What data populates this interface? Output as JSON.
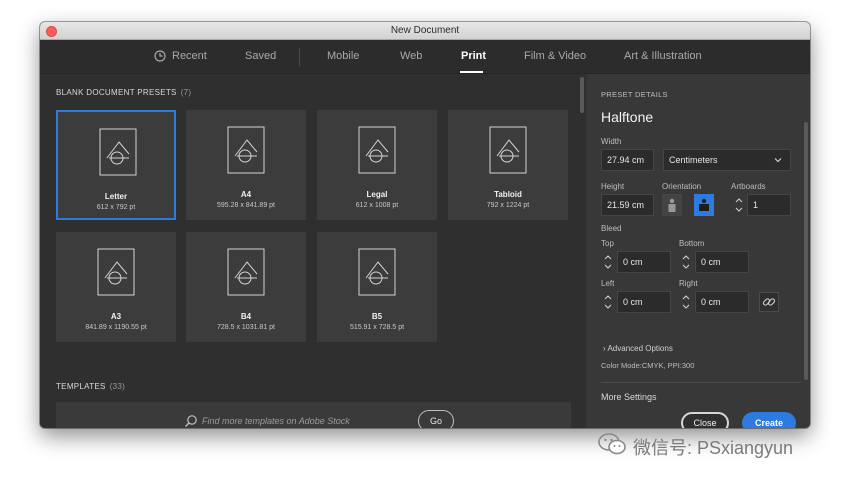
{
  "window": {
    "title": "New Document"
  },
  "tabs": [
    {
      "label": "Recent",
      "icon": "clock-icon",
      "active": false
    },
    {
      "label": "Saved",
      "active": false
    },
    {
      "label": "Mobile",
      "active": false
    },
    {
      "label": "Web",
      "active": false
    },
    {
      "label": "Print",
      "active": true
    },
    {
      "label": "Film & Video",
      "active": false
    },
    {
      "label": "Art & Illustration",
      "active": false
    }
  ],
  "presets_section": {
    "title": "BLANK DOCUMENT PRESETS",
    "count": "(7)"
  },
  "presets": [
    {
      "name": "Letter",
      "size": "612 x 792 pt",
      "selected": true
    },
    {
      "name": "A4",
      "size": "595.28 x 841.89 pt",
      "selected": false
    },
    {
      "name": "Legal",
      "size": "612 x 1008 pt",
      "selected": false
    },
    {
      "name": "Tabloid",
      "size": "792 x 1224 pt",
      "selected": false
    },
    {
      "name": "A3",
      "size": "841.89 x 1190.55 pt",
      "selected": false
    },
    {
      "name": "B4",
      "size": "728.5 x 1031.81 pt",
      "selected": false
    },
    {
      "name": "B5",
      "size": "515.91 x 728.5 pt",
      "selected": false
    }
  ],
  "templates_section": {
    "title": "TEMPLATES",
    "count": "(33)"
  },
  "search": {
    "placeholder": "Find more templates on Adobe Stock",
    "go_label": "Go"
  },
  "details": {
    "section_label": "PRESET DETAILS",
    "preset_name": "Halftone",
    "width_label": "Width",
    "width_value": "27.94 cm",
    "units_value": "Centimeters",
    "height_label": "Height",
    "height_value": "21.59 cm",
    "orientation_label": "Orientation",
    "orientation_selected": "landscape",
    "artboards_label": "Artboards",
    "artboards_value": "1",
    "bleed_label": "Bleed",
    "top_label": "Top",
    "top_value": "0 cm",
    "bottom_label": "Bottom",
    "bottom_value": "0 cm",
    "left_label": "Left",
    "left_value": "0 cm",
    "right_label": "Right",
    "right_value": "0 cm",
    "advanced_label": "Advanced Options",
    "color_mode": "Color Mode:CMYK, PPI:300",
    "more_settings": "More Settings"
  },
  "buttons": {
    "close": "Close",
    "create": "Create"
  },
  "watermark": {
    "text": "微信号: PSxiangyun"
  },
  "colors": {
    "accent": "#2d7be0",
    "panel": "#383838",
    "background": "#2f2f2f"
  }
}
